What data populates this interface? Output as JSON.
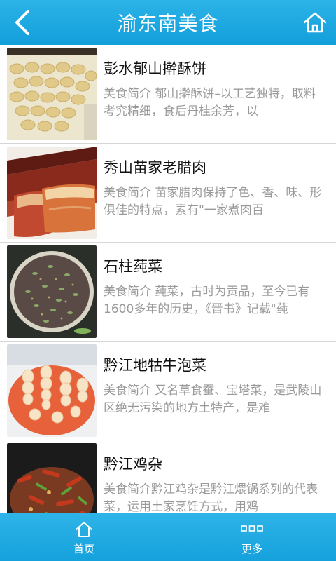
{
  "header": {
    "title": "渝东南美食",
    "back_icon": "chevron-left-icon",
    "home_icon": "home-icon"
  },
  "colors": {
    "accent": "#1aa5df",
    "title_text": "#111111",
    "desc_text": "#9a9a9a"
  },
  "items": [
    {
      "title": "彭水郁山擀酥饼",
      "desc": "美食简介 郁山擀酥饼–以工艺独特，取料考究精细，食后丹桂余芳，以"
    },
    {
      "title": "秀山苗家老腊肉",
      "desc": "美食简介 苗家腊肉保持了色、香、味、形俱佳的特点，素有\"一家煮肉百"
    },
    {
      "title": "石柱莼菜",
      "desc": "美食简介 莼菜，古时为贡品，至今已有1600多年的历史，《晋书》记载\"莼"
    },
    {
      "title": "黔江地牯牛泡菜",
      "desc": "美食简介 又名草食蚕、宝塔菜，是武陵山区绝无污染的地方土特产，是难"
    },
    {
      "title": "黔江鸡杂",
      "desc": "美食简介黔江鸡杂是黔江煨锅系列的代表菜，运用土家烹饪方式，用鸡"
    }
  ],
  "bottom_nav": {
    "home_label": "首页",
    "home_icon": "home-icon",
    "more_label": "更多",
    "more_icon": "grid-dots-icon"
  }
}
